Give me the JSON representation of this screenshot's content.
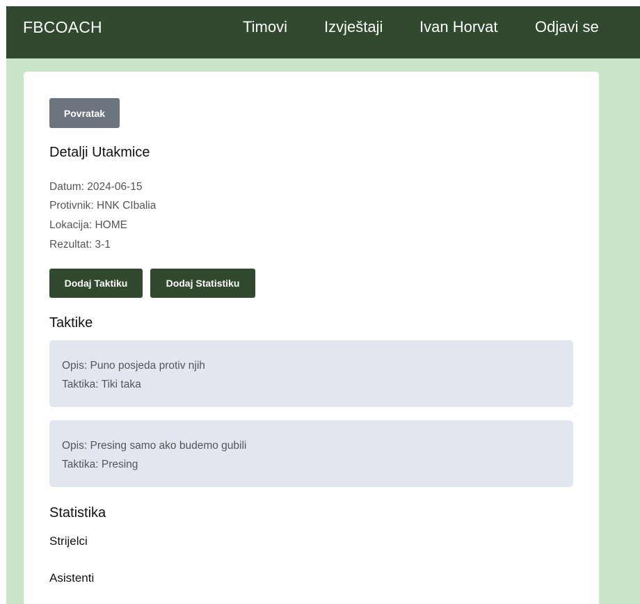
{
  "navbar": {
    "brand": "FBCOACH",
    "links": [
      "Timovi",
      "Izvještaji",
      "Ivan Horvat",
      "Odjavi se"
    ]
  },
  "back_button": "Povratak",
  "match": {
    "heading": "Detalji Utakmice",
    "date": "Datum: 2024-06-15",
    "opponent": "Protivnik: HNK CIbalia",
    "location": "Lokacija: HOME",
    "result": "Rezultat: 3-1"
  },
  "actions": {
    "add_tactic": "Dodaj Taktiku",
    "add_stats": "Dodaj Statistiku"
  },
  "tactics": {
    "heading": "Taktike",
    "items": [
      {
        "description": "Opis: Puno posjeda protiv njih",
        "tactic": "Taktika: Tiki taka"
      },
      {
        "description": "Opis: Presing samo ako budemo gubili",
        "tactic": "Taktika: Presing"
      }
    ]
  },
  "statistics": {
    "heading": "Statistika",
    "scorers": "Strijelci",
    "assists": "Asistenti"
  },
  "colors": {
    "navbar": "#31492f",
    "page_background": "#c9e6c9",
    "primary_button": "#31492f",
    "secondary_button": "#6c757d",
    "tactic_card": "#e1e6ef"
  }
}
